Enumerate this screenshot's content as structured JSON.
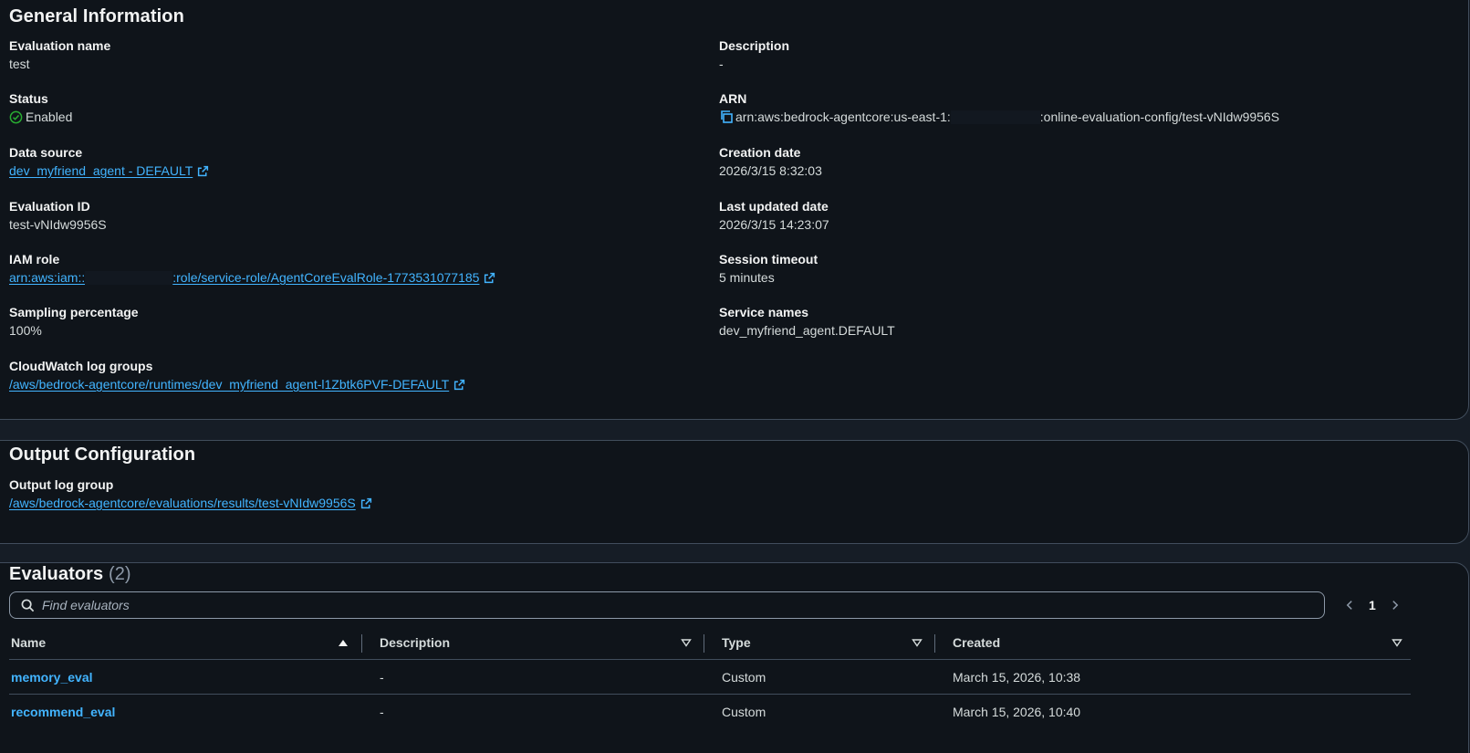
{
  "general": {
    "title": "General Information",
    "evaluation_name": {
      "label": "Evaluation name",
      "value": "test"
    },
    "status": {
      "label": "Status",
      "value": "Enabled"
    },
    "data_source": {
      "label": "Data source",
      "value": "dev_myfriend_agent - DEFAULT"
    },
    "evaluation_id": {
      "label": "Evaluation ID",
      "value": "test-vNIdw9956S"
    },
    "iam_role": {
      "label": "IAM role",
      "prefix": "arn:aws:iam::",
      "suffix": ":role/service-role/AgentCoreEvalRole-1773531077185"
    },
    "sampling": {
      "label": "Sampling percentage",
      "value": "100%"
    },
    "cloudwatch": {
      "label": "CloudWatch log groups",
      "value": "/aws/bedrock-agentcore/runtimes/dev_myfriend_agent-l1Zbtk6PVF-DEFAULT"
    },
    "description": {
      "label": "Description",
      "value": "-"
    },
    "arn": {
      "label": "ARN",
      "prefix": "arn:aws:bedrock-agentcore:us-east-1:",
      "suffix": ":online-evaluation-config/test-vNIdw9956S"
    },
    "creation_date": {
      "label": "Creation date",
      "value": "2026/3/15 8:32:03"
    },
    "last_updated": {
      "label": "Last updated date",
      "value": "2026/3/15 14:23:07"
    },
    "session_timeout": {
      "label": "Session timeout",
      "value": "5 minutes"
    },
    "service_names": {
      "label": "Service names",
      "value": "dev_myfriend_agent.DEFAULT"
    }
  },
  "output": {
    "title": "Output Configuration",
    "log_group": {
      "label": "Output log group",
      "value": "/aws/bedrock-agentcore/evaluations/results/test-vNIdw9956S"
    }
  },
  "evaluators": {
    "title": "Evaluators",
    "count": "(2)",
    "search_placeholder": "Find evaluators",
    "page": "1",
    "columns": {
      "name": "Name",
      "description": "Description",
      "type": "Type",
      "created": "Created"
    },
    "rows": [
      {
        "name": "memory_eval",
        "description": "-",
        "type": "Custom",
        "created": "March 15, 2026, 10:38"
      },
      {
        "name": "recommend_eval",
        "description": "-",
        "type": "Custom",
        "created": "March 15, 2026, 10:40"
      }
    ]
  },
  "colors": {
    "background": "#161d26",
    "panel": "#0f141a",
    "border": "#414d5c",
    "link": "#42b4ff",
    "success": "#29ad32"
  },
  "icons": [
    "external-link-icon",
    "success-check-icon",
    "copy-icon",
    "search-icon",
    "chevron-left-icon",
    "chevron-right-icon",
    "sort-ascending-icon",
    "sort-dropdown-icon"
  ]
}
